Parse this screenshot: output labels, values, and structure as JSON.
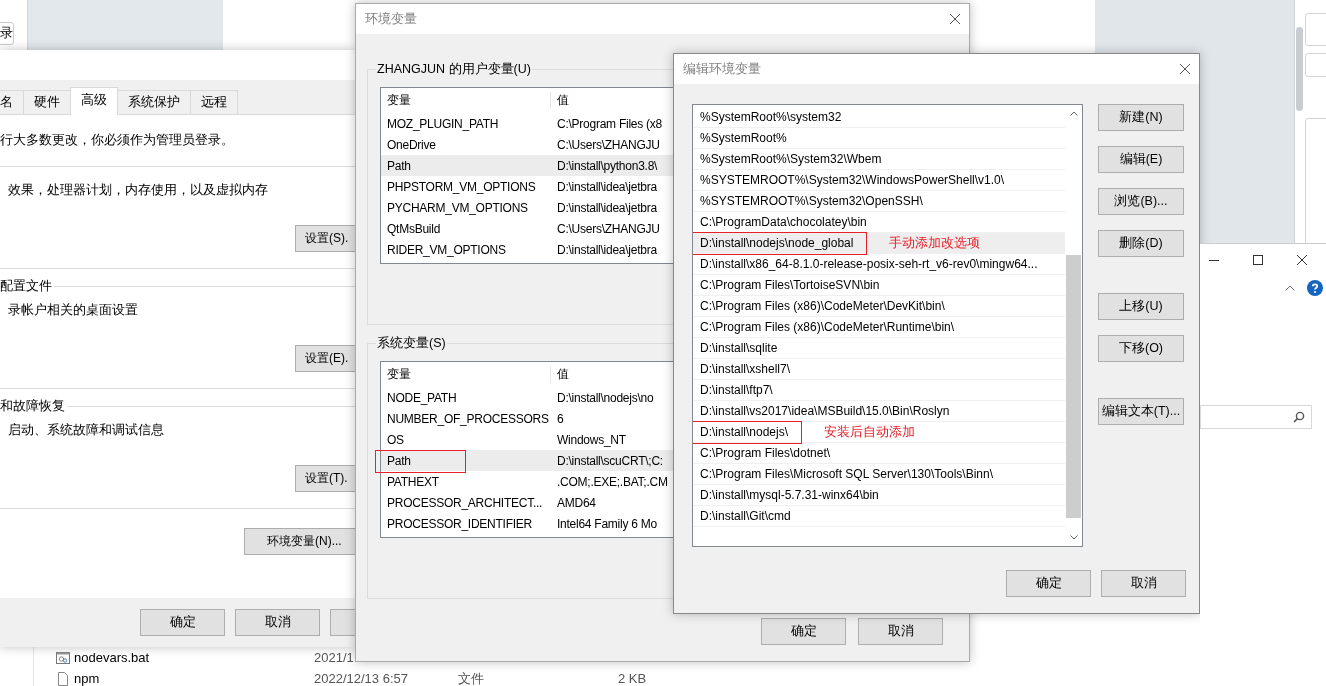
{
  "desktop": {
    "corner_button": "录",
    "files": [
      {
        "kind": "script",
        "name": "nodevars.bat",
        "date": "2021/1"
      },
      {
        "kind": "file",
        "name": "npm",
        "date": "2022/12/13 6:57",
        "type": "文件",
        "size": "2 KB"
      }
    ]
  },
  "system_properties": {
    "tabs": [
      {
        "label": "名",
        "selected": false
      },
      {
        "label": "硬件",
        "selected": false
      },
      {
        "label": "高级",
        "selected": true
      },
      {
        "label": "系统保护",
        "selected": false
      },
      {
        "label": "远程",
        "selected": false
      }
    ],
    "notice": "行大多数更改，你必须作为管理员登录。",
    "sections": [
      {
        "description": "效果，处理器计划，内存使用，以及虚拟内存",
        "button": "设置(S)."
      },
      {
        "heading": "配置文件",
        "description": "录帐户相关的桌面设置",
        "button": "设置(E)."
      },
      {
        "heading": "和故障恢复",
        "description": "启动、系统故障和调试信息",
        "button": "设置(T)."
      }
    ],
    "env_button": "环境变量(N)...",
    "footer_buttons": [
      "确定",
      "取消"
    ]
  },
  "environment_variables": {
    "title": "环境变量",
    "groups": [
      {
        "label": "ZHANGJUN 的用户变量(U)",
        "columns": [
          "变量",
          "值"
        ],
        "rows": [
          {
            "name": "MOZ_PLUGIN_PATH",
            "value": "C:\\Program Files (x8",
            "selected": false,
            "marked": false
          },
          {
            "name": "OneDrive",
            "value": "C:\\Users\\ZHANGJU",
            "selected": false,
            "marked": false
          },
          {
            "name": "Path",
            "value": "D:\\install\\python3.8\\",
            "selected": true,
            "marked": false
          },
          {
            "name": "PHPSTORM_VM_OPTIONS",
            "value": "D:\\install\\idea\\jetbra",
            "selected": false,
            "marked": false
          },
          {
            "name": "PYCHARM_VM_OPTIONS",
            "value": "D:\\install\\idea\\jetbra",
            "selected": false,
            "marked": false
          },
          {
            "name": "QtMsBuild",
            "value": "C:\\Users\\ZHANGJU",
            "selected": false,
            "marked": false
          },
          {
            "name": "RIDER_VM_OPTIONS",
            "value": "D:\\install\\idea\\jetbra",
            "selected": false,
            "marked": false
          }
        ]
      },
      {
        "label": "系统变量(S)",
        "columns": [
          "变量",
          "值"
        ],
        "rows": [
          {
            "name": "NODE_PATH",
            "value": "D:\\install\\nodejs\\no",
            "selected": false,
            "marked": false
          },
          {
            "name": "NUMBER_OF_PROCESSORS",
            "value": "6",
            "selected": false,
            "marked": false
          },
          {
            "name": "OS",
            "value": "Windows_NT",
            "selected": false,
            "marked": false
          },
          {
            "name": "Path",
            "value": "D:\\install\\scuCRT\\;C:",
            "selected": true,
            "marked": true
          },
          {
            "name": "PATHEXT",
            "value": ".COM;.EXE;.BAT;.CM",
            "selected": false,
            "marked": false
          },
          {
            "name": "PROCESSOR_ARCHITECT...",
            "value": "AMD64",
            "selected": false,
            "marked": false
          },
          {
            "name": "PROCESSOR_IDENTIFIER",
            "value": "Intel64 Family 6 Mo",
            "selected": false,
            "marked": false
          }
        ]
      }
    ],
    "footer_buttons": [
      "确定",
      "取消"
    ]
  },
  "edit_dialog": {
    "title": "编辑环境变量",
    "items": [
      {
        "text": "%SystemRoot%\\system32",
        "selected": false,
        "marked": false
      },
      {
        "text": "%SystemRoot%",
        "selected": false,
        "marked": false
      },
      {
        "text": "%SystemRoot%\\System32\\Wbem",
        "selected": false,
        "marked": false
      },
      {
        "text": "%SYSTEMROOT%\\System32\\WindowsPowerShell\\v1.0\\",
        "selected": false,
        "marked": false
      },
      {
        "text": "%SYSTEMROOT%\\System32\\OpenSSH\\",
        "selected": false,
        "marked": false
      },
      {
        "text": "C:\\ProgramData\\chocolatey\\bin",
        "selected": false,
        "marked": false
      },
      {
        "text": "D:\\install\\nodejs\\node_global",
        "selected": true,
        "marked": true,
        "note": "手动添加改选项"
      },
      {
        "text": "D:\\install\\x86_64-8.1.0-release-posix-seh-rt_v6-rev0\\mingw64...",
        "selected": false,
        "marked": false
      },
      {
        "text": "C:\\Program Files\\TortoiseSVN\\bin",
        "selected": false,
        "marked": false
      },
      {
        "text": "C:\\Program Files (x86)\\CodeMeter\\DevKit\\bin\\",
        "selected": false,
        "marked": false
      },
      {
        "text": "C:\\Program Files (x86)\\CodeMeter\\Runtime\\bin\\",
        "selected": false,
        "marked": false
      },
      {
        "text": "D:\\install\\sqlite",
        "selected": false,
        "marked": false
      },
      {
        "text": "D:\\install\\xshell7\\",
        "selected": false,
        "marked": false
      },
      {
        "text": "D:\\install\\ftp7\\",
        "selected": false,
        "marked": false
      },
      {
        "text": "D:\\install\\vs2017\\idea\\MSBuild\\15.0\\Bin\\Roslyn",
        "selected": false,
        "marked": false
      },
      {
        "text": "D:\\install\\nodejs\\",
        "selected": false,
        "marked": true,
        "note": "安装后自动添加"
      },
      {
        "text": "C:\\Program Files\\dotnet\\",
        "selected": false,
        "marked": false
      },
      {
        "text": "C:\\Program Files\\Microsoft SQL Server\\130\\Tools\\Binn\\",
        "selected": false,
        "marked": false
      },
      {
        "text": "D:\\install\\mysql-5.7.31-winx64\\bin",
        "selected": false,
        "marked": false
      },
      {
        "text": "D:\\install\\Git\\cmd",
        "selected": false,
        "marked": false
      }
    ],
    "button_groups": [
      [
        "新建(N)",
        "编辑(E)",
        "浏览(B)...",
        "删除(D)"
      ],
      [
        "上移(U)",
        "下移(O)"
      ],
      [
        "编辑文本(T)..."
      ]
    ],
    "footer_buttons": [
      "确定",
      "取消"
    ]
  }
}
